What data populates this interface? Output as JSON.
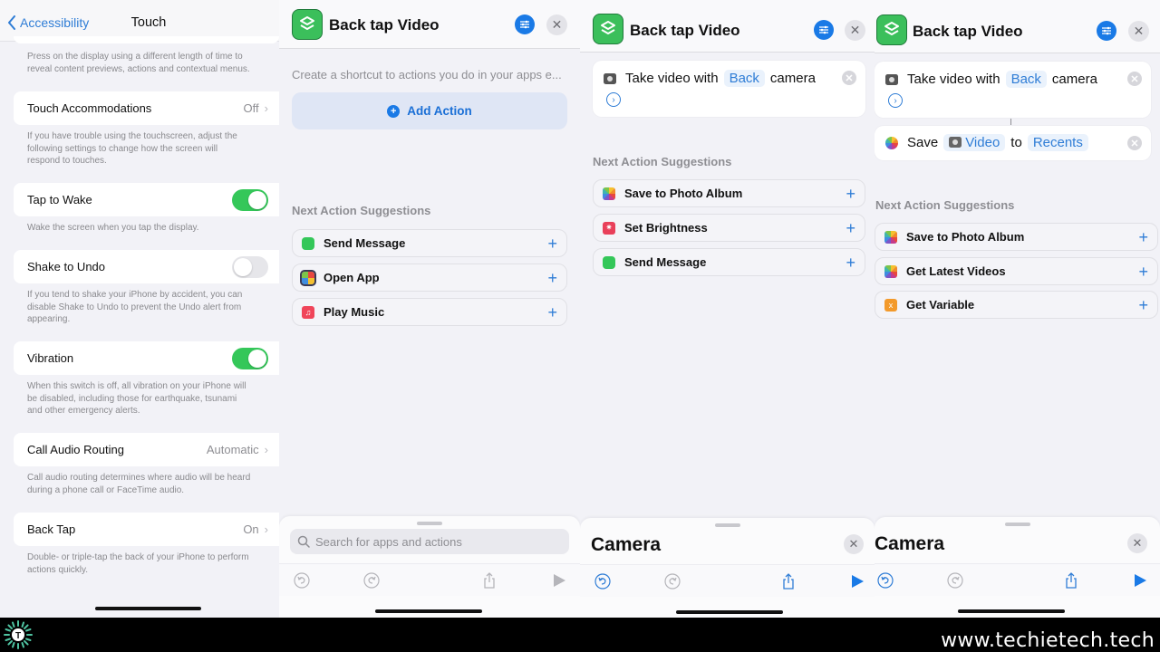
{
  "settings": {
    "back_label": "Accessibility",
    "title": "Touch",
    "haptic_footer": "Press on the display using a different length of time to reveal content previews, actions and contextual menus.",
    "rows": [
      {
        "label": "Touch Accommodations",
        "value": "Off",
        "footer": "If you have trouble using the touchscreen, adjust the following settings to change how the screen will respond to touches."
      },
      {
        "label": "Tap to Wake",
        "toggle": true,
        "footer": "Wake the screen when you tap the display."
      },
      {
        "label": "Shake to Undo",
        "toggle": false,
        "footer": "If you tend to shake your iPhone by accident, you can disable Shake to Undo to prevent the Undo alert from appearing."
      },
      {
        "label": "Vibration",
        "toggle": true,
        "footer": "When this switch is off, all vibration on your iPhone will be disabled, including those for earthquake, tsunami and other emergency alerts."
      },
      {
        "label": "Call Audio Routing",
        "value": "Automatic",
        "footer": "Call audio routing determines where audio will be heard during a phone call or FaceTime audio."
      },
      {
        "label": "Back Tap",
        "value": "On",
        "footer": "Double- or triple-tap the back of your iPhone to perform actions quickly."
      }
    ]
  },
  "shortcut_empty": {
    "title": "Back tap Video",
    "hint": "Create a shortcut to actions you do in your apps e...",
    "add_action_label": "Add Action",
    "suggestions_label": "Next Action Suggestions",
    "suggestions": [
      {
        "label": "Send Message",
        "icon": "messages-icon"
      },
      {
        "label": "Open App",
        "icon": "open-app-icon"
      },
      {
        "label": "Play Music",
        "icon": "music-icon"
      }
    ],
    "search_placeholder": "Search for apps and actions"
  },
  "shortcut_one": {
    "title": "Back tap Video",
    "action": {
      "prefix": "Take video with",
      "token": "Back",
      "suffix": "camera"
    },
    "suggestions_label": "Next Action Suggestions",
    "suggestions": [
      {
        "label": "Save to Photo Album",
        "icon": "photos-icon"
      },
      {
        "label": "Set Brightness",
        "icon": "brightness-icon"
      },
      {
        "label": "Send Message",
        "icon": "messages-icon"
      }
    ],
    "sheet_title": "Camera"
  },
  "shortcut_two": {
    "title": "Back tap Video",
    "action1": {
      "prefix": "Take video with",
      "token": "Back",
      "suffix": "camera"
    },
    "action2": {
      "prefix": "Save",
      "token1": "Video",
      "mid": "to",
      "token2": "Recents"
    },
    "suggestions_label": "Next Action Suggestions",
    "suggestions": [
      {
        "label": "Save to Photo Album",
        "icon": "photos-icon"
      },
      {
        "label": "Get Latest Videos",
        "icon": "photos-icon"
      },
      {
        "label": "Get Variable",
        "icon": "variable-icon"
      }
    ],
    "sheet_title": "Camera"
  },
  "colors": {
    "accent": "#1a7ae6",
    "toggle_on": "#34c759",
    "shortcuts_green": "#3bbf5b"
  },
  "watermark": {
    "text": "www.techietech.tech",
    "logo_letter": "T"
  }
}
